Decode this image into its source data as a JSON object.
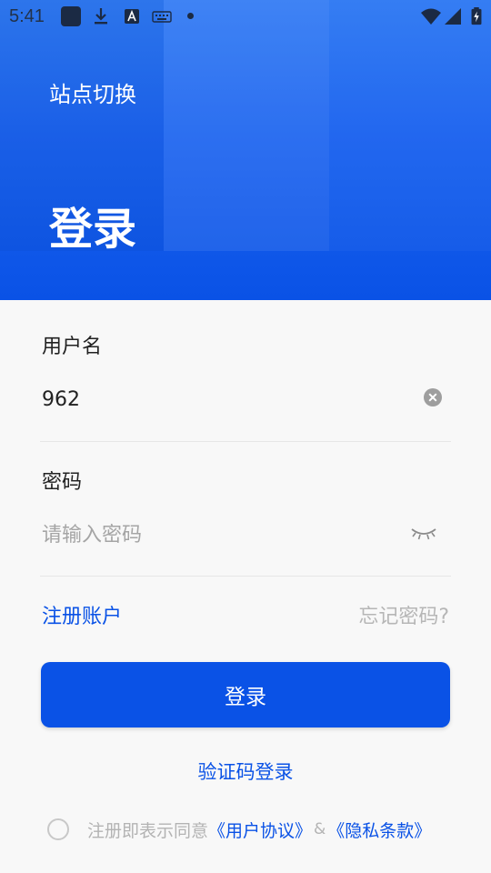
{
  "status_bar": {
    "time": "5:41",
    "icons": [
      "notification-app-icon",
      "download-icon",
      "a-icon",
      "keyboard-icon",
      "dot-icon",
      "wifi-icon",
      "signal-icon",
      "battery-icon"
    ]
  },
  "header": {
    "site_switch_label": "站点切换",
    "title": "登录"
  },
  "form": {
    "username": {
      "label": "用户名",
      "value": "962",
      "clear_icon": "clear-icon"
    },
    "password": {
      "label": "密码",
      "placeholder": "请输入密码",
      "value": "",
      "visibility_icon": "eye-closed-icon"
    },
    "register_label": "注册账户",
    "forgot_label": "忘记密码?",
    "login_button_label": "登录",
    "sms_login_label": "验证码登录"
  },
  "agreement": {
    "checked": false,
    "text": "注册即表示同意",
    "user_agreement": "《用户协议》",
    "amp": "&",
    "privacy_policy": "《隐私条款》"
  },
  "colors": {
    "primary": "#0a52e6",
    "header_top": "#2f79f3",
    "muted": "#b3b3b3"
  }
}
